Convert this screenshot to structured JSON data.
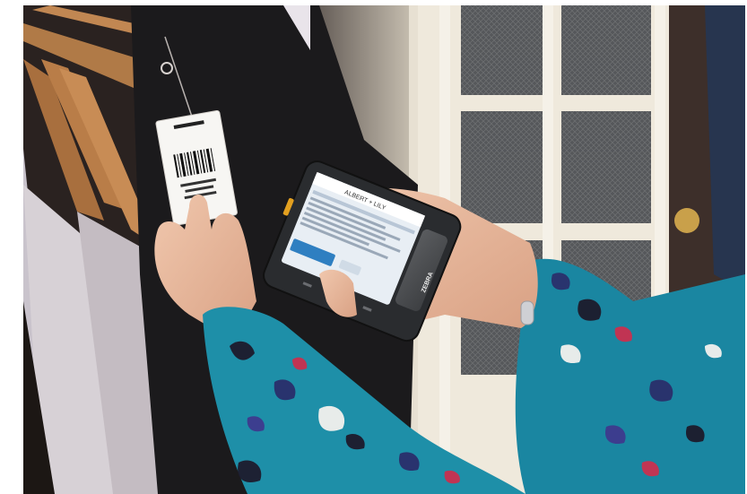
{
  "photo": {
    "subject": "Shopper scanning a clothing tag barcode with a handheld mobile computer",
    "phone_screen": {
      "header_text": "ALBERT + LILY",
      "button_label": ""
    },
    "phone_brand": "ZEBRA",
    "colors": {
      "wall": "#cfc9bf",
      "door": "#ede6d6",
      "sleeve": "#1e8fa8",
      "phone_body": "#2a2c2f",
      "screen": "#e8eef4",
      "accent_blue": "#2f7fc1"
    }
  }
}
